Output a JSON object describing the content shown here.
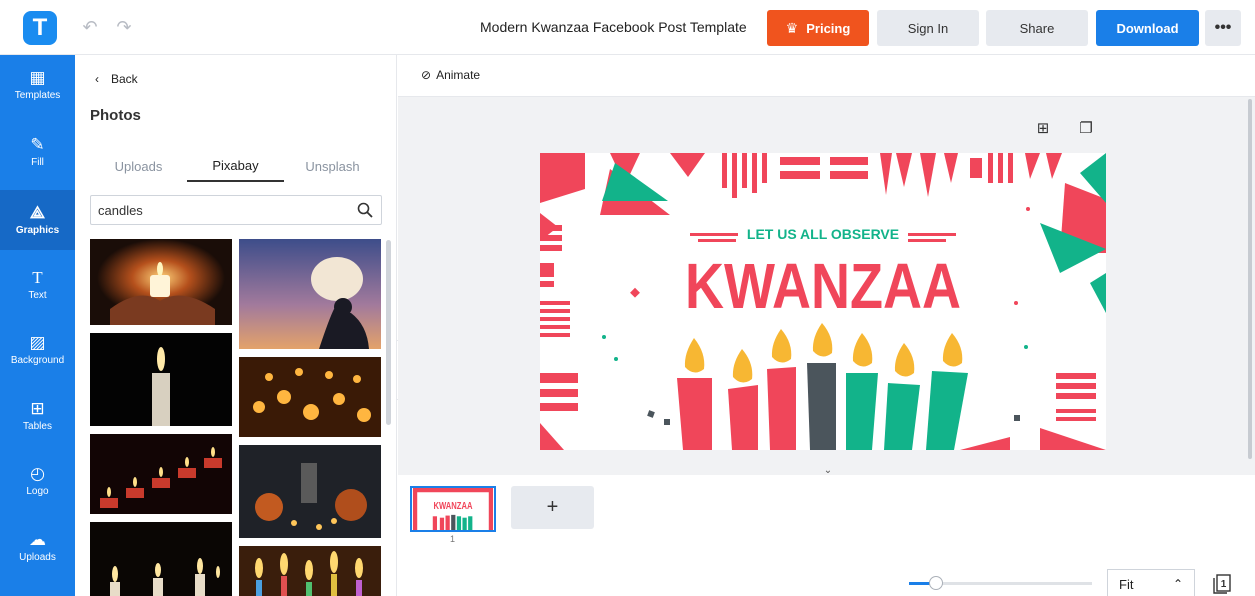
{
  "app": {
    "logo_letter": "T",
    "document_title": "Modern Kwanzaa Facebook Post Template",
    "undo_icon": "undo-icon",
    "redo_icon": "redo-icon"
  },
  "header": {
    "pricing_label": "Pricing",
    "signin_label": "Sign In",
    "share_label": "Share",
    "download_label": "Download",
    "more_label": "•••"
  },
  "rail": {
    "items": [
      {
        "label": "Templates",
        "icon": "templates-icon"
      },
      {
        "label": "Fill",
        "icon": "fill-icon"
      },
      {
        "label": "Graphics",
        "icon": "graphics-icon"
      },
      {
        "label": "Text",
        "icon": "text-icon"
      },
      {
        "label": "Background",
        "icon": "background-icon"
      },
      {
        "label": "Tables",
        "icon": "tables-icon"
      },
      {
        "label": "Logo",
        "icon": "logo-icon"
      },
      {
        "label": "Uploads",
        "icon": "uploads-icon"
      }
    ]
  },
  "panel": {
    "back_label": "Back",
    "title": "Photos",
    "tabs": [
      "Uploads",
      "Pixabay",
      "Unsplash"
    ],
    "active_tab": "Pixabay",
    "search_value": "candles"
  },
  "canvas": {
    "animate_label": "Animate",
    "headline_small": "LET US ALL OBSERVE",
    "headline_big": "KWANZAA",
    "colors": {
      "red": "#f0465a",
      "green": "#12b38a",
      "orange": "#f7b733",
      "gray": "#4b555c"
    }
  },
  "pages": {
    "page_number": "1",
    "add_label": "+",
    "zoom_label": "Fit",
    "zoom_fraction": 0.15
  },
  "colors": {
    "accent": "#1a7fe8",
    "pricing": "#f0541e"
  }
}
